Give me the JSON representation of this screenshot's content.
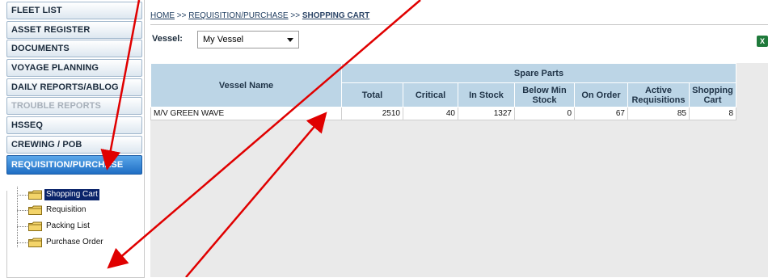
{
  "nav": {
    "items": [
      {
        "label": "FLEET LIST",
        "state": "normal"
      },
      {
        "label": "ASSET REGISTER",
        "state": "normal"
      },
      {
        "label": "DOCUMENTS",
        "state": "normal"
      },
      {
        "label": "VOYAGE PLANNING",
        "state": "normal"
      },
      {
        "label": "DAILY REPORTS/ABLOG",
        "state": "normal"
      },
      {
        "label": "TROUBLE REPORTS",
        "state": "disabled"
      },
      {
        "label": "HSSEQ",
        "state": "normal"
      },
      {
        "label": "CREWING / POB",
        "state": "normal"
      },
      {
        "label": "REQUISITION/PURCHASE",
        "state": "active"
      }
    ],
    "subitems": [
      {
        "label": "Shopping Cart",
        "selected": true
      },
      {
        "label": "Requisition",
        "selected": false
      },
      {
        "label": "Packing List",
        "selected": false
      },
      {
        "label": "Purchase Order",
        "selected": false
      }
    ]
  },
  "breadcrumb": {
    "home": "HOME",
    "sep1": ">>",
    "section": "REQUISITION/PURCHASE",
    "sep2": ">>",
    "current": "SHOPPING CART"
  },
  "vessel": {
    "label": "Vessel:",
    "selected": "My Vessel"
  },
  "table": {
    "vessel_name_header": "Vessel Name",
    "group_header": "Spare Parts",
    "columns": [
      "Total",
      "Critical",
      "In Stock",
      "Below Min Stock",
      "On Order",
      "Active Requisitions",
      "Shopping Cart"
    ],
    "rows": [
      {
        "name": "M/V GREEN WAVE",
        "values": [
          "2510",
          "40",
          "1327",
          "0",
          "67",
          "85",
          "8"
        ]
      }
    ]
  },
  "colors": {
    "header_bg": "#bcd5e6",
    "active_nav": "#1f6ec4",
    "annotation_arrow": "#e00000"
  },
  "icons": {
    "excel": "excel-export-icon",
    "folder": "folder-icon"
  }
}
